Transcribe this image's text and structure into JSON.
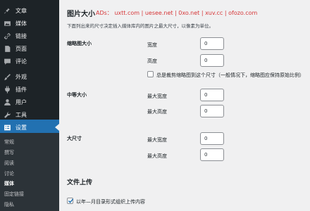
{
  "sidebar": {
    "items": [
      {
        "label": "文章",
        "icon": "pushpin-icon"
      },
      {
        "label": "媒体",
        "icon": "media-icon"
      },
      {
        "label": "链接",
        "icon": "link-icon"
      },
      {
        "label": "页面",
        "icon": "page-icon"
      },
      {
        "label": "评论",
        "icon": "comment-icon"
      },
      {
        "label": "外观",
        "icon": "paintbrush-icon"
      },
      {
        "label": "插件",
        "icon": "plugin-icon"
      },
      {
        "label": "用户",
        "icon": "user-icon"
      },
      {
        "label": "工具",
        "icon": "wrench-icon"
      },
      {
        "label": "设置",
        "icon": "settings-icon"
      }
    ],
    "submenu": [
      "常规",
      "撰写",
      "阅读",
      "讨论",
      "媒体",
      "固定链接",
      "隐私"
    ],
    "current_submenu": "媒体"
  },
  "main": {
    "title": "图片大小",
    "ad_line": "ADs： uxtt.com | uesee.net | 0xo.net | xuv.cc | ofozo.com",
    "description": "下面列出来的尺寸决定插入媒体库内的图片之最大尺寸，以像素为单位。",
    "thumbnail": {
      "section_label": "缩略图大小",
      "width_label": "宽度",
      "width_value": "0",
      "height_label": "高度",
      "height_value": "0",
      "crop_label": "总是裁剪缩略图到这个尺寸（一般情况下，缩略图应保持原始比例）"
    },
    "medium": {
      "section_label": "中等大小",
      "max_width_label": "最大宽度",
      "max_width_value": "0",
      "max_height_label": "最大高度",
      "max_height_value": "0"
    },
    "large": {
      "section_label": "大尺寸",
      "max_width_label": "最大宽度",
      "max_width_value": "0",
      "max_height_label": "最大高度",
      "max_height_value": "0"
    },
    "uploads": {
      "title": "文件上传",
      "organize_label": "以年—月目录形式组织上传内容",
      "organize_checked": true
    }
  },
  "colors": {
    "sidebar_bg": "#1d2327",
    "submenu_bg": "#2c3338",
    "active_bg": "#2271b1",
    "ad_text": "#d63638",
    "page_bg": "#f0f0f1"
  }
}
